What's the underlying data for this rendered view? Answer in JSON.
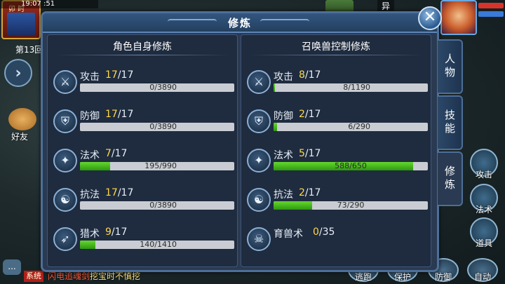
{
  "hud": {
    "time_badge_label": "卯 时",
    "status_time": "19:07 :51",
    "round_label": "第13回",
    "friend_label": "好友",
    "chat_icon": "...",
    "system_tag": "系统",
    "system_message_prefix": "闪电追魂剑",
    "system_message_suffix": "挖宝时不慎挖",
    "top_right_text": "异",
    "side_buttons": [
      {
        "label": "攻击",
        "icon": "sword-icon"
      },
      {
        "label": "法术",
        "icon": "magic-icon"
      },
      {
        "label": "道具",
        "icon": "item-icon"
      }
    ],
    "bottom_buttons": [
      {
        "label": "逃跑"
      },
      {
        "label": "保护"
      },
      {
        "label": "防御"
      },
      {
        "label": "自动"
      }
    ]
  },
  "dialog": {
    "title": "修炼",
    "close_icon": "close-icon",
    "left_column": {
      "header": "角色自身修炼",
      "skills": [
        {
          "name": "攻击",
          "level": "17",
          "max": "/17",
          "progress": "0/3890",
          "fill": 0.0,
          "icon": "attack-icon"
        },
        {
          "name": "防御",
          "level": "17",
          "max": "/17",
          "progress": "0/3890",
          "fill": 0.0,
          "icon": "defense-icon"
        },
        {
          "name": "法术",
          "level": "7",
          "max": "/17",
          "progress": "195/990",
          "fill": 0.197,
          "icon": "spell-icon"
        },
        {
          "name": "抗法",
          "level": "17",
          "max": "/17",
          "progress": "0/3890",
          "fill": 0.0,
          "icon": "resist-icon"
        },
        {
          "name": "猎术",
          "level": "9",
          "max": "/17",
          "progress": "140/1410",
          "fill": 0.099,
          "icon": "hunt-icon"
        }
      ]
    },
    "right_column": {
      "header": "召唤兽控制修炼",
      "skills": [
        {
          "name": "攻击",
          "level": "8",
          "max": "/17",
          "progress": "8/1190",
          "fill": 0.007,
          "icon": "attack-icon"
        },
        {
          "name": "防御",
          "level": "2",
          "max": "/17",
          "progress": "6/290",
          "fill": 0.021,
          "icon": "defense-icon"
        },
        {
          "name": "法术",
          "level": "5",
          "max": "/17",
          "progress": "588/650",
          "fill": 0.905,
          "icon": "spell-icon"
        },
        {
          "name": "抗法",
          "level": "2",
          "max": "/17",
          "progress": "73/290",
          "fill": 0.252,
          "icon": "resist-icon"
        }
      ],
      "extra": {
        "name": "育兽术",
        "level": "0",
        "max": "/35",
        "icon": "beast-icon"
      }
    },
    "tabs": [
      {
        "label": "人物",
        "active": false
      },
      {
        "label": "技能",
        "active": false
      },
      {
        "label": "修炼",
        "active": true
      }
    ]
  }
}
